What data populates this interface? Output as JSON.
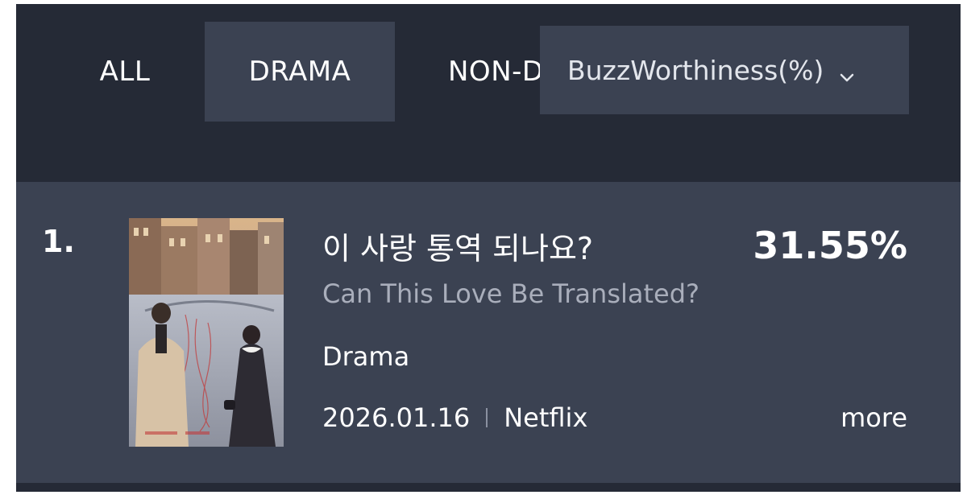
{
  "tabs": {
    "all": "ALL",
    "drama": "DRAMA",
    "non_drama": "NON-DRAMA"
  },
  "sort_dropdown": {
    "selected": "BuzzWorthiness(%)",
    "icon": "chevron-down-icon"
  },
  "ranking": [
    {
      "rank": "1.",
      "title_ko": "이 사랑 통역 되나요?",
      "title_en": "Can This Love Be Translated?",
      "score": "31.55%",
      "genre": "Drama",
      "date": "2026.01.16",
      "platform": "Netflix",
      "more_label": "more"
    }
  ],
  "colors": {
    "background": "#252a36",
    "card": "#3b4252",
    "text": "#ffffff",
    "muted": "#a9aebb"
  }
}
